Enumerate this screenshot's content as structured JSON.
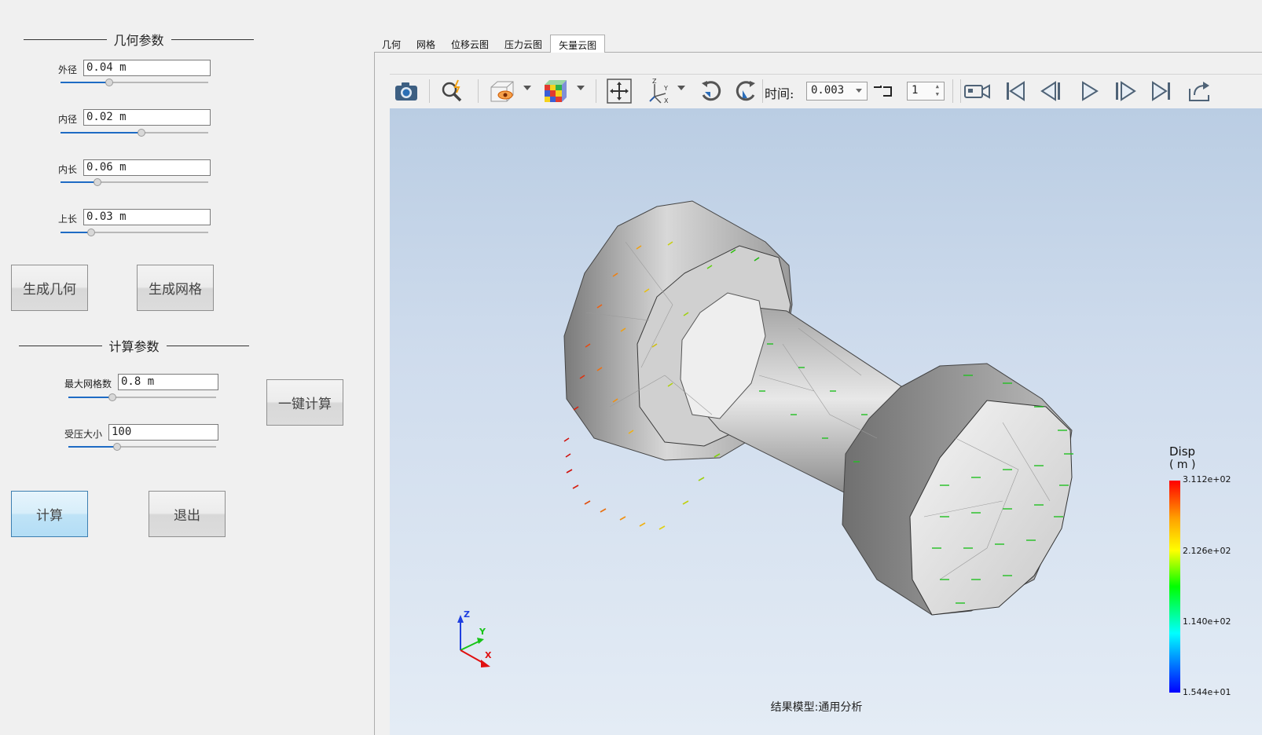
{
  "geometry_section": {
    "title": "几何参数",
    "params": [
      {
        "label": "外径",
        "value": "0.04 m",
        "slider_fraction": 0.33
      },
      {
        "label": "内径",
        "value": "0.02 m",
        "slider_fraction": 0.55
      },
      {
        "label": "内长",
        "value": "0.06 m",
        "slider_fraction": 0.25
      },
      {
        "label": "上长",
        "value": "0.03 m",
        "slider_fraction": 0.21
      }
    ],
    "generate_geometry_label": "生成几何",
    "generate_mesh_label": "生成网格"
  },
  "compute_section": {
    "title": "计算参数",
    "params": [
      {
        "label": "最大网格数",
        "value": "0.8 m",
        "slider_fraction": 0.3
      },
      {
        "label": "受压大小",
        "value": "100",
        "slider_fraction": 0.33
      }
    ],
    "one_click_label": "一键计算",
    "compute_label": "计算",
    "exit_label": "退出"
  },
  "tabs": [
    {
      "label": "几何",
      "active": false
    },
    {
      "label": "网格",
      "active": false
    },
    {
      "label": "位移云图",
      "active": false
    },
    {
      "label": "压力云图",
      "active": false
    },
    {
      "label": "矢量云图",
      "active": true
    }
  ],
  "toolbar": {
    "time_label": "时间:",
    "time_value": "0.003",
    "step_value": "1",
    "icons": [
      "camera-icon",
      "zoom-icon",
      "view-mode-icon",
      "color-map-icon",
      "fit-view-icon",
      "axes-icon",
      "rotate-cw-icon",
      "rotate-ccw-icon",
      "record-icon",
      "first-frame-icon",
      "prev-frame-icon",
      "play-icon",
      "next-frame-icon",
      "last-frame-icon",
      "export-icon"
    ]
  },
  "viewport": {
    "status": "结果模型:通用分析",
    "axis_labels": {
      "x": "X",
      "y": "Y",
      "z": "Z"
    },
    "legend": {
      "title": "Disp",
      "unit": "( m )",
      "values": [
        "3.112e+02",
        "2.126e+02",
        "1.140e+02",
        "1.544e+01"
      ]
    }
  },
  "colors": {
    "slider_fill": "#1e6bc4",
    "compute_button": "#bfe3f7",
    "viewport_top": "#bacde3",
    "viewport_bottom": "#e4ecf5"
  }
}
